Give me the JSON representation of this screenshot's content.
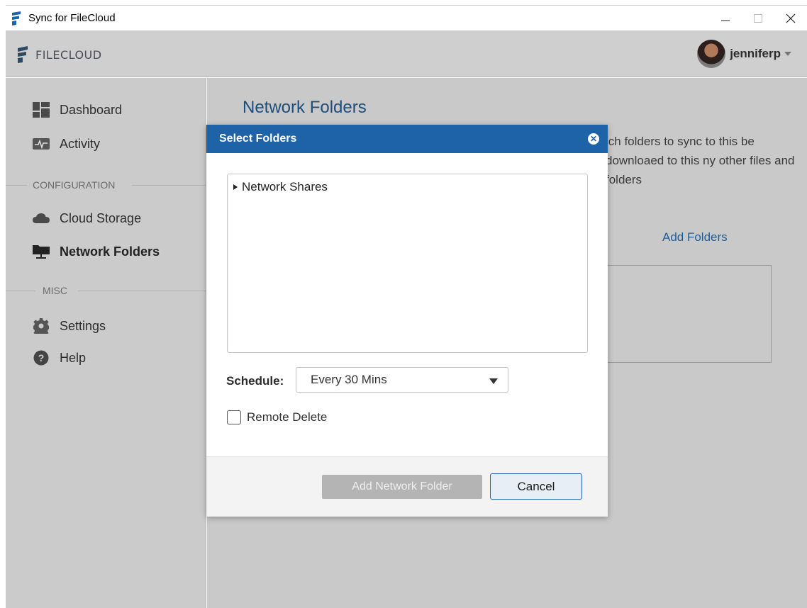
{
  "window": {
    "title": "Sync for FileCloud",
    "controls": [
      "minimize-icon",
      "maximize-icon",
      "close-icon"
    ]
  },
  "header": {
    "logo_text": "FILECLOUD",
    "username": "jenniferp"
  },
  "sidebar": {
    "items": [
      {
        "label": "Dashboard",
        "icon": "dashboard-icon"
      },
      {
        "label": "Activity",
        "icon": "activity-icon"
      }
    ],
    "configuration_label": "CONFIGURATION",
    "config_items": [
      {
        "label": "Cloud Storage",
        "icon": "cloud-icon"
      },
      {
        "label": "Network Folders",
        "icon": "network-folder-icon",
        "active": true
      }
    ],
    "misc_label": "MISC",
    "misc_items": [
      {
        "label": "Settings",
        "icon": "gear-icon"
      },
      {
        "label": "Help",
        "icon": "help-icon"
      }
    ]
  },
  "main": {
    "title": "Network Folders",
    "description": "ich folders to sync to this be downloaed to this ny other files and folders",
    "add_folders_label": "Add Folders"
  },
  "modal": {
    "title": "Select Folders",
    "tree": [
      {
        "label": "Network Shares",
        "expanded": false
      }
    ],
    "schedule_label": "Schedule:",
    "schedule_value": "Every 30 Mins",
    "remote_delete_label": "Remote Delete",
    "remote_delete_checked": false,
    "add_button": "Add Network Folder",
    "cancel_button": "Cancel"
  },
  "colors": {
    "accent": "#1e63a8",
    "title_blue": "#1e4d7b",
    "disabled_button": "#b4b4b4"
  }
}
